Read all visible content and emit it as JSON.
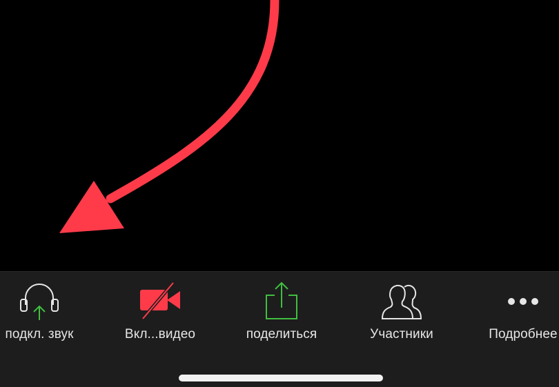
{
  "toolbar": {
    "items": [
      {
        "label": "подкл. звук",
        "icon": "headphones-icon"
      },
      {
        "label": "Вкл...видео",
        "icon": "video-off-icon"
      },
      {
        "label": "поделиться",
        "icon": "share-icon"
      },
      {
        "label": "Участники",
        "icon": "participants-icon"
      },
      {
        "label": "Подробнее",
        "icon": "more-icon"
      }
    ]
  },
  "colors": {
    "background": "#000000",
    "toolbar_bg": "#1d1d1d",
    "annotation_arrow": "#ff3b4a",
    "accent_green": "#3fbf3f",
    "video_off_red": "#ff3b4a",
    "label_text": "#e6e6e6"
  }
}
